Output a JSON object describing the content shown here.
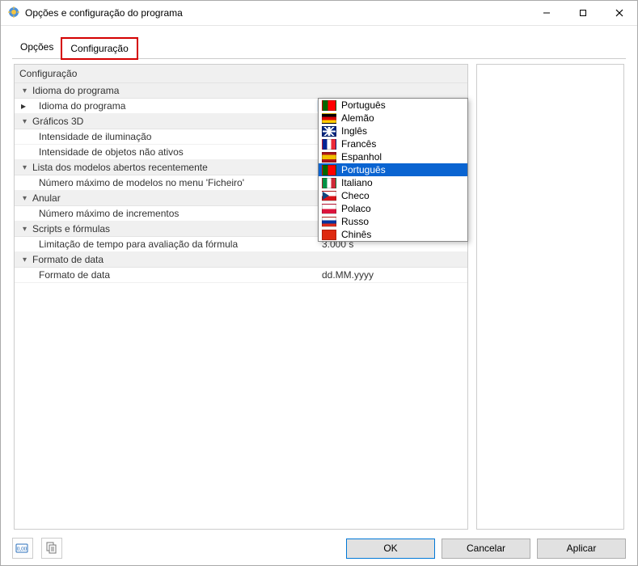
{
  "window": {
    "title": "Opções e configuração do programa"
  },
  "tabs": {
    "options": "Opções",
    "config": "Configuração"
  },
  "grid": {
    "header": "Configuração",
    "cat_lang": "Idioma do programa",
    "row_lang": "Idioma do programa",
    "combo_value": "Português",
    "cat_3d": "Gráficos 3D",
    "row_light": "Intensidade de iluminação",
    "row_inactive": "Intensidade de objetos não ativos",
    "cat_recent": "Lista dos modelos abertos recentemente",
    "row_maxmodels": "Número máximo de modelos no menu 'Ficheiro'",
    "cat_undo": "Anular",
    "row_maxinc": "Número máximo de incrementos",
    "cat_scripts": "Scripts e fórmulas",
    "row_timelimit": "Limitação de tempo para avaliação da fórmula",
    "val_timelimit": "3.000 s",
    "cat_dateformat": "Formato de data",
    "row_dateformat": "Formato de data",
    "val_dateformat": "dd.MM.yyyy"
  },
  "dropdown": {
    "items": [
      {
        "label": "Português",
        "flag": "pt"
      },
      {
        "label": "Alemão",
        "flag": "de"
      },
      {
        "label": "Inglês",
        "flag": "uk"
      },
      {
        "label": "Francês",
        "flag": "fr"
      },
      {
        "label": "Espanhol",
        "flag": "es"
      },
      {
        "label": "Português",
        "flag": "pt",
        "selected": true
      },
      {
        "label": "Italiano",
        "flag": "it"
      },
      {
        "label": "Checo",
        "flag": "cz"
      },
      {
        "label": "Polaco",
        "flag": "pl"
      },
      {
        "label": "Russo",
        "flag": "ru"
      },
      {
        "label": "Chinês",
        "flag": "cn"
      }
    ]
  },
  "buttons": {
    "ok": "OK",
    "cancel": "Cancelar",
    "apply": "Aplicar"
  }
}
